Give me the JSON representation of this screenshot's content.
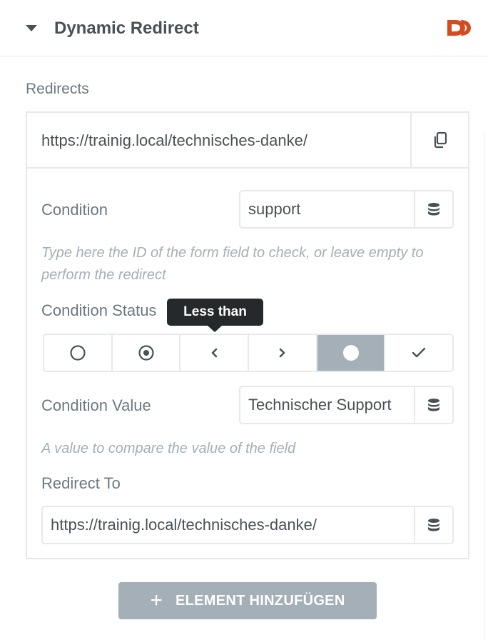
{
  "section": {
    "title": "Dynamic Redirect",
    "logo": "dynamic-ooo-logo-icon",
    "logo_color": "#d44b1f"
  },
  "repeater": {
    "label": "Redirects",
    "item": {
      "title": "https://trainig.local/technisches-danke/",
      "condition": {
        "label": "Condition",
        "value": "support",
        "description": "Type here the ID of the form field to check, or leave empty to perform the redirect"
      },
      "condition_status": {
        "label": "Condition Status",
        "tooltip": "Less than",
        "options": [
          "empty-circle-icon",
          "target-circle-icon",
          "chevron-left-icon",
          "chevron-right-icon",
          "filled-circle-icon",
          "check-icon"
        ],
        "active_index": 4
      },
      "condition_value": {
        "label": "Condition Value",
        "value": "Technischer Support",
        "description": "A value to compare the value of the field"
      },
      "redirect_to": {
        "label": "Redirect To",
        "value": "https://trainig.local/technisches-danke/"
      }
    },
    "add_button": "ELEMENT HINZUFÜGEN"
  },
  "colors": {
    "active": "#a4afb7",
    "tooltip_bg": "#26292c",
    "text": "#6d7882",
    "border": "#e6e8ea"
  }
}
